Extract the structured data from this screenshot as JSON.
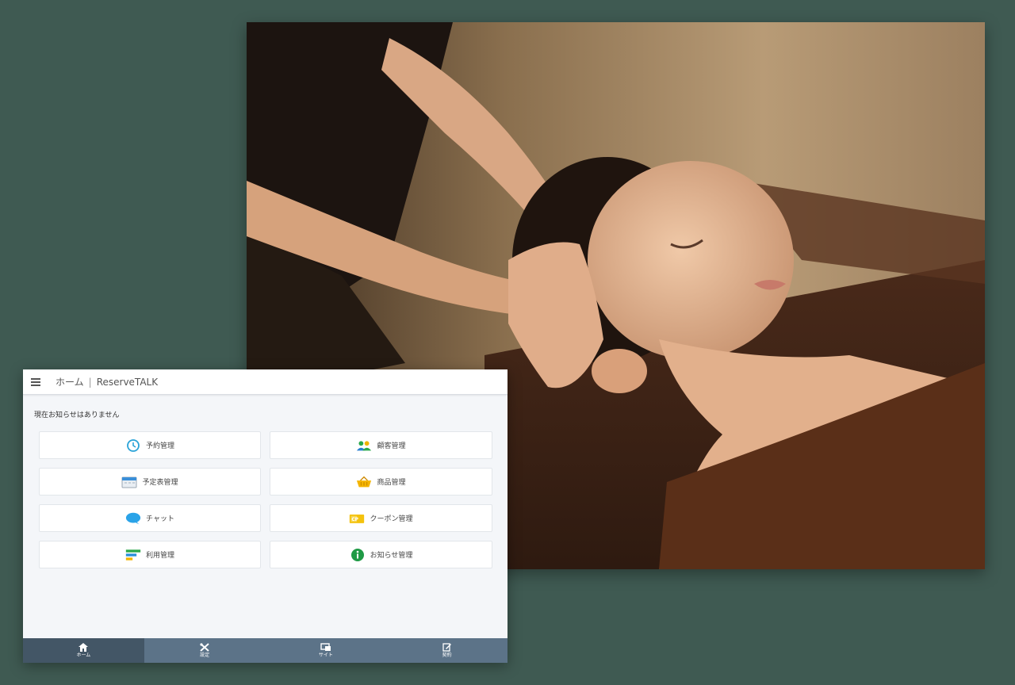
{
  "header": {
    "home": "ホーム",
    "separator": "|",
    "app_name": "ReserveTALK"
  },
  "notice": "現在お知らせはありません",
  "menu": [
    {
      "label": "予約管理",
      "icon": "clock-icon"
    },
    {
      "label": "顧客管理",
      "icon": "users-icon"
    },
    {
      "label": "予定表管理",
      "icon": "calendar-icon"
    },
    {
      "label": "商品管理",
      "icon": "basket-icon"
    },
    {
      "label": "チャット",
      "icon": "chat-bubble-icon"
    },
    {
      "label": "クーポン管理",
      "icon": "coupon-icon"
    },
    {
      "label": "利用管理",
      "icon": "bars-icon"
    },
    {
      "label": "お知らせ管理",
      "icon": "info-icon"
    }
  ],
  "tabs": [
    {
      "label": "ホーム",
      "icon": "home-icon",
      "active": true
    },
    {
      "label": "設定",
      "icon": "tools-icon",
      "active": false
    },
    {
      "label": "サイト",
      "icon": "site-icon",
      "active": false
    },
    {
      "label": "契約",
      "icon": "contract-icon",
      "active": false
    }
  ],
  "colors": {
    "background": "#3f5a52",
    "tabbar": "#5c7388",
    "tab_active": "#435666",
    "panel": "#f4f6f9"
  }
}
